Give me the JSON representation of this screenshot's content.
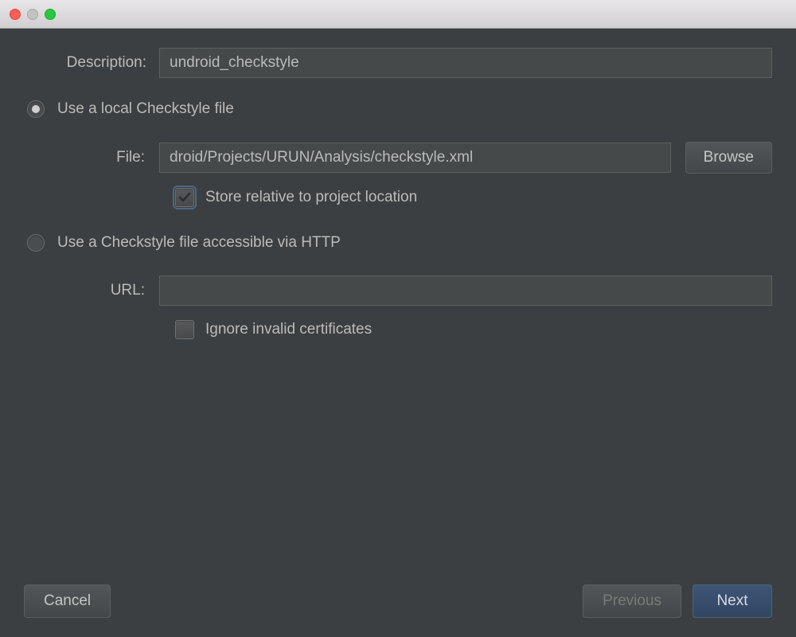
{
  "titlebar": {
    "close": "close",
    "minimize": "minimize",
    "maximize": "maximize"
  },
  "form": {
    "description_label": "Description:",
    "description_value": "undroid_checkstyle",
    "radio_local": "Use a local Checkstyle file",
    "file_label": "File:",
    "file_value": "droid/Projects/URUN/Analysis/checkstyle.xml",
    "browse_label": "Browse",
    "store_relative": "Store relative to project location",
    "radio_http": "Use a Checkstyle file accessible via HTTP",
    "url_label": "URL:",
    "url_value": "",
    "ignore_certs": "Ignore invalid certificates"
  },
  "buttons": {
    "cancel": "Cancel",
    "previous": "Previous",
    "next": "Next"
  }
}
